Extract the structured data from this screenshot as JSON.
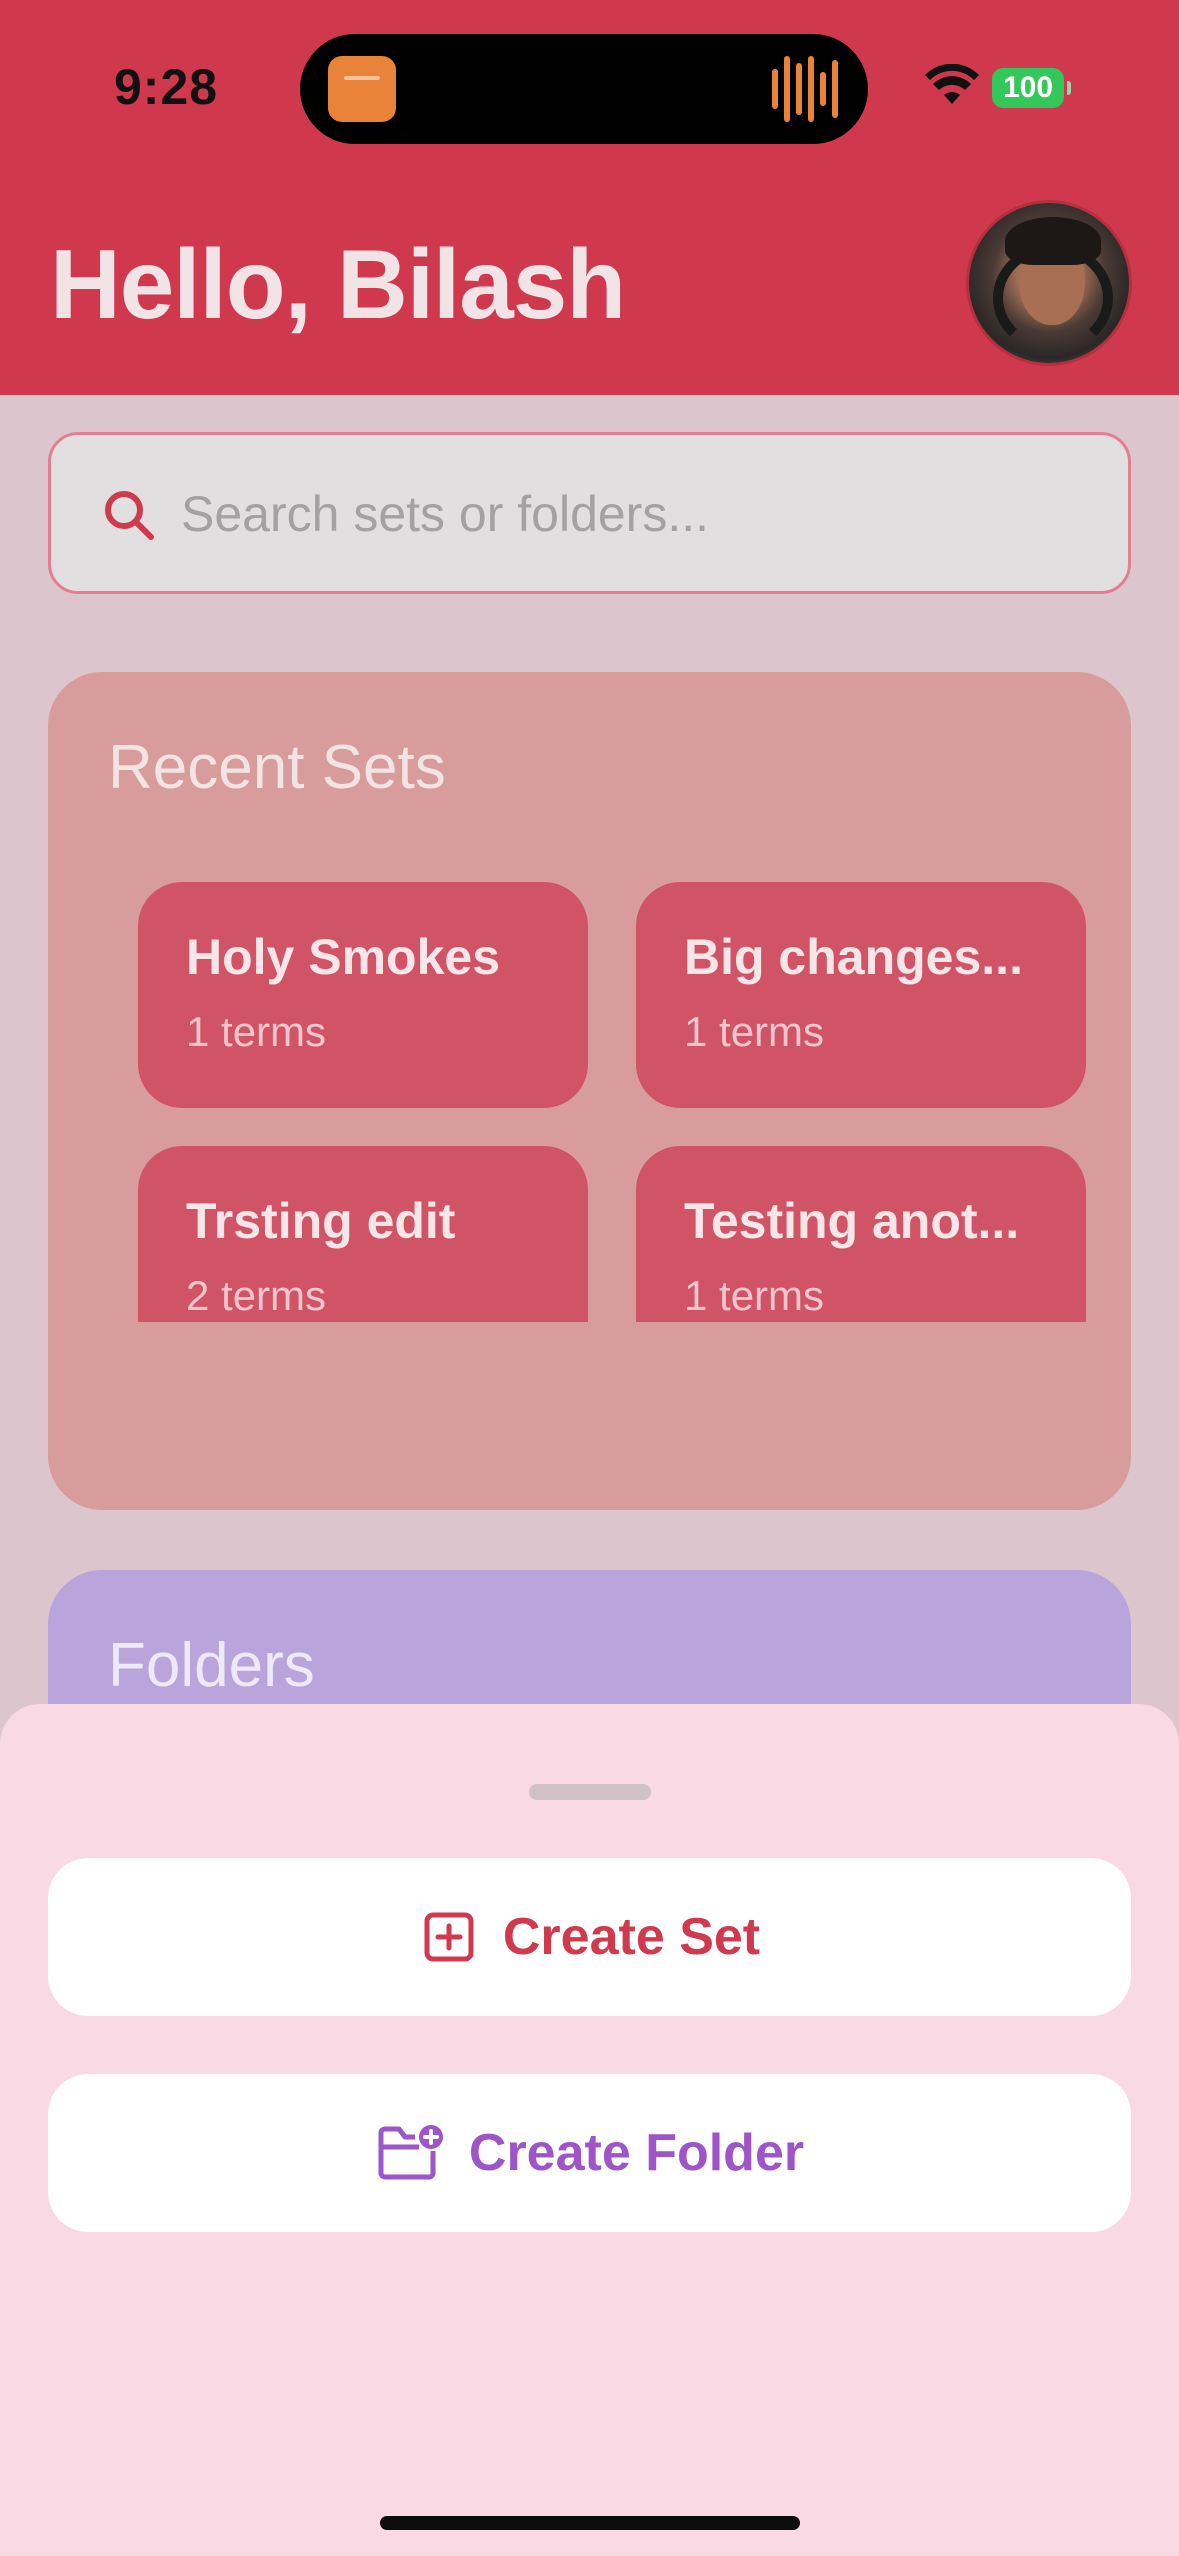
{
  "status_bar": {
    "time": "9:28",
    "battery": "100",
    "wifi_icon": "wifi-icon"
  },
  "header": {
    "greeting": "Hello, Bilash",
    "avatar": "profile-avatar"
  },
  "search": {
    "placeholder": "Search sets or folders..."
  },
  "recent_sets": {
    "title": "Recent Sets",
    "items": [
      {
        "title": "Holy Smokes",
        "subtitle": "1 terms"
      },
      {
        "title": "Big changes...",
        "subtitle": "1 terms"
      },
      {
        "title": "Trsting edit",
        "subtitle": "2 terms"
      },
      {
        "title": "Testing anot...",
        "subtitle": "1 terms"
      }
    ]
  },
  "folders": {
    "title": "Folders"
  },
  "sheet": {
    "create_set": "Create Set",
    "create_folder": "Create Folder"
  },
  "colors": {
    "brand": "#d0384d",
    "folder_accent": "#9e55c8",
    "card": "#d15466"
  }
}
